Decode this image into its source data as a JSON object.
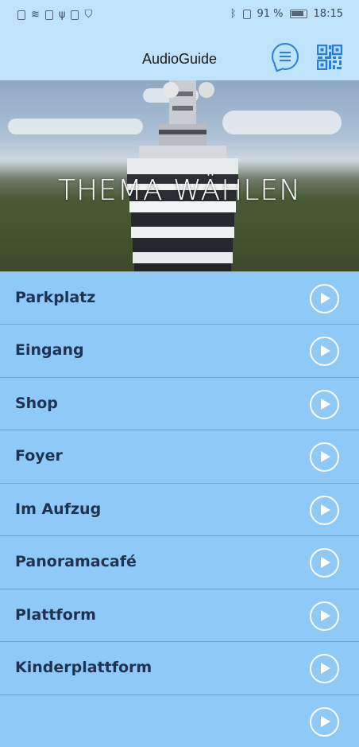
{
  "status_bar": {
    "battery_percent": "91 %",
    "time": "18:15"
  },
  "header": {
    "title": "AudioGuide",
    "menu_icon": "chat-list-icon",
    "qr_icon": "qr-code-icon"
  },
  "hero": {
    "title": "THEMA WÄHLEN"
  },
  "topics": [
    {
      "label": "Parkplatz"
    },
    {
      "label": "Eingang"
    },
    {
      "label": "Shop"
    },
    {
      "label": "Foyer"
    },
    {
      "label": "Im Aufzug"
    },
    {
      "label": "Panoramacafé"
    },
    {
      "label": "Plattform"
    },
    {
      "label": "Kinderplattform"
    }
  ],
  "colors": {
    "header_bg": "#bfe3fb",
    "list_bg": "#8ec9f7",
    "label_text": "#1f3350",
    "accent": "#2a7fd8"
  }
}
